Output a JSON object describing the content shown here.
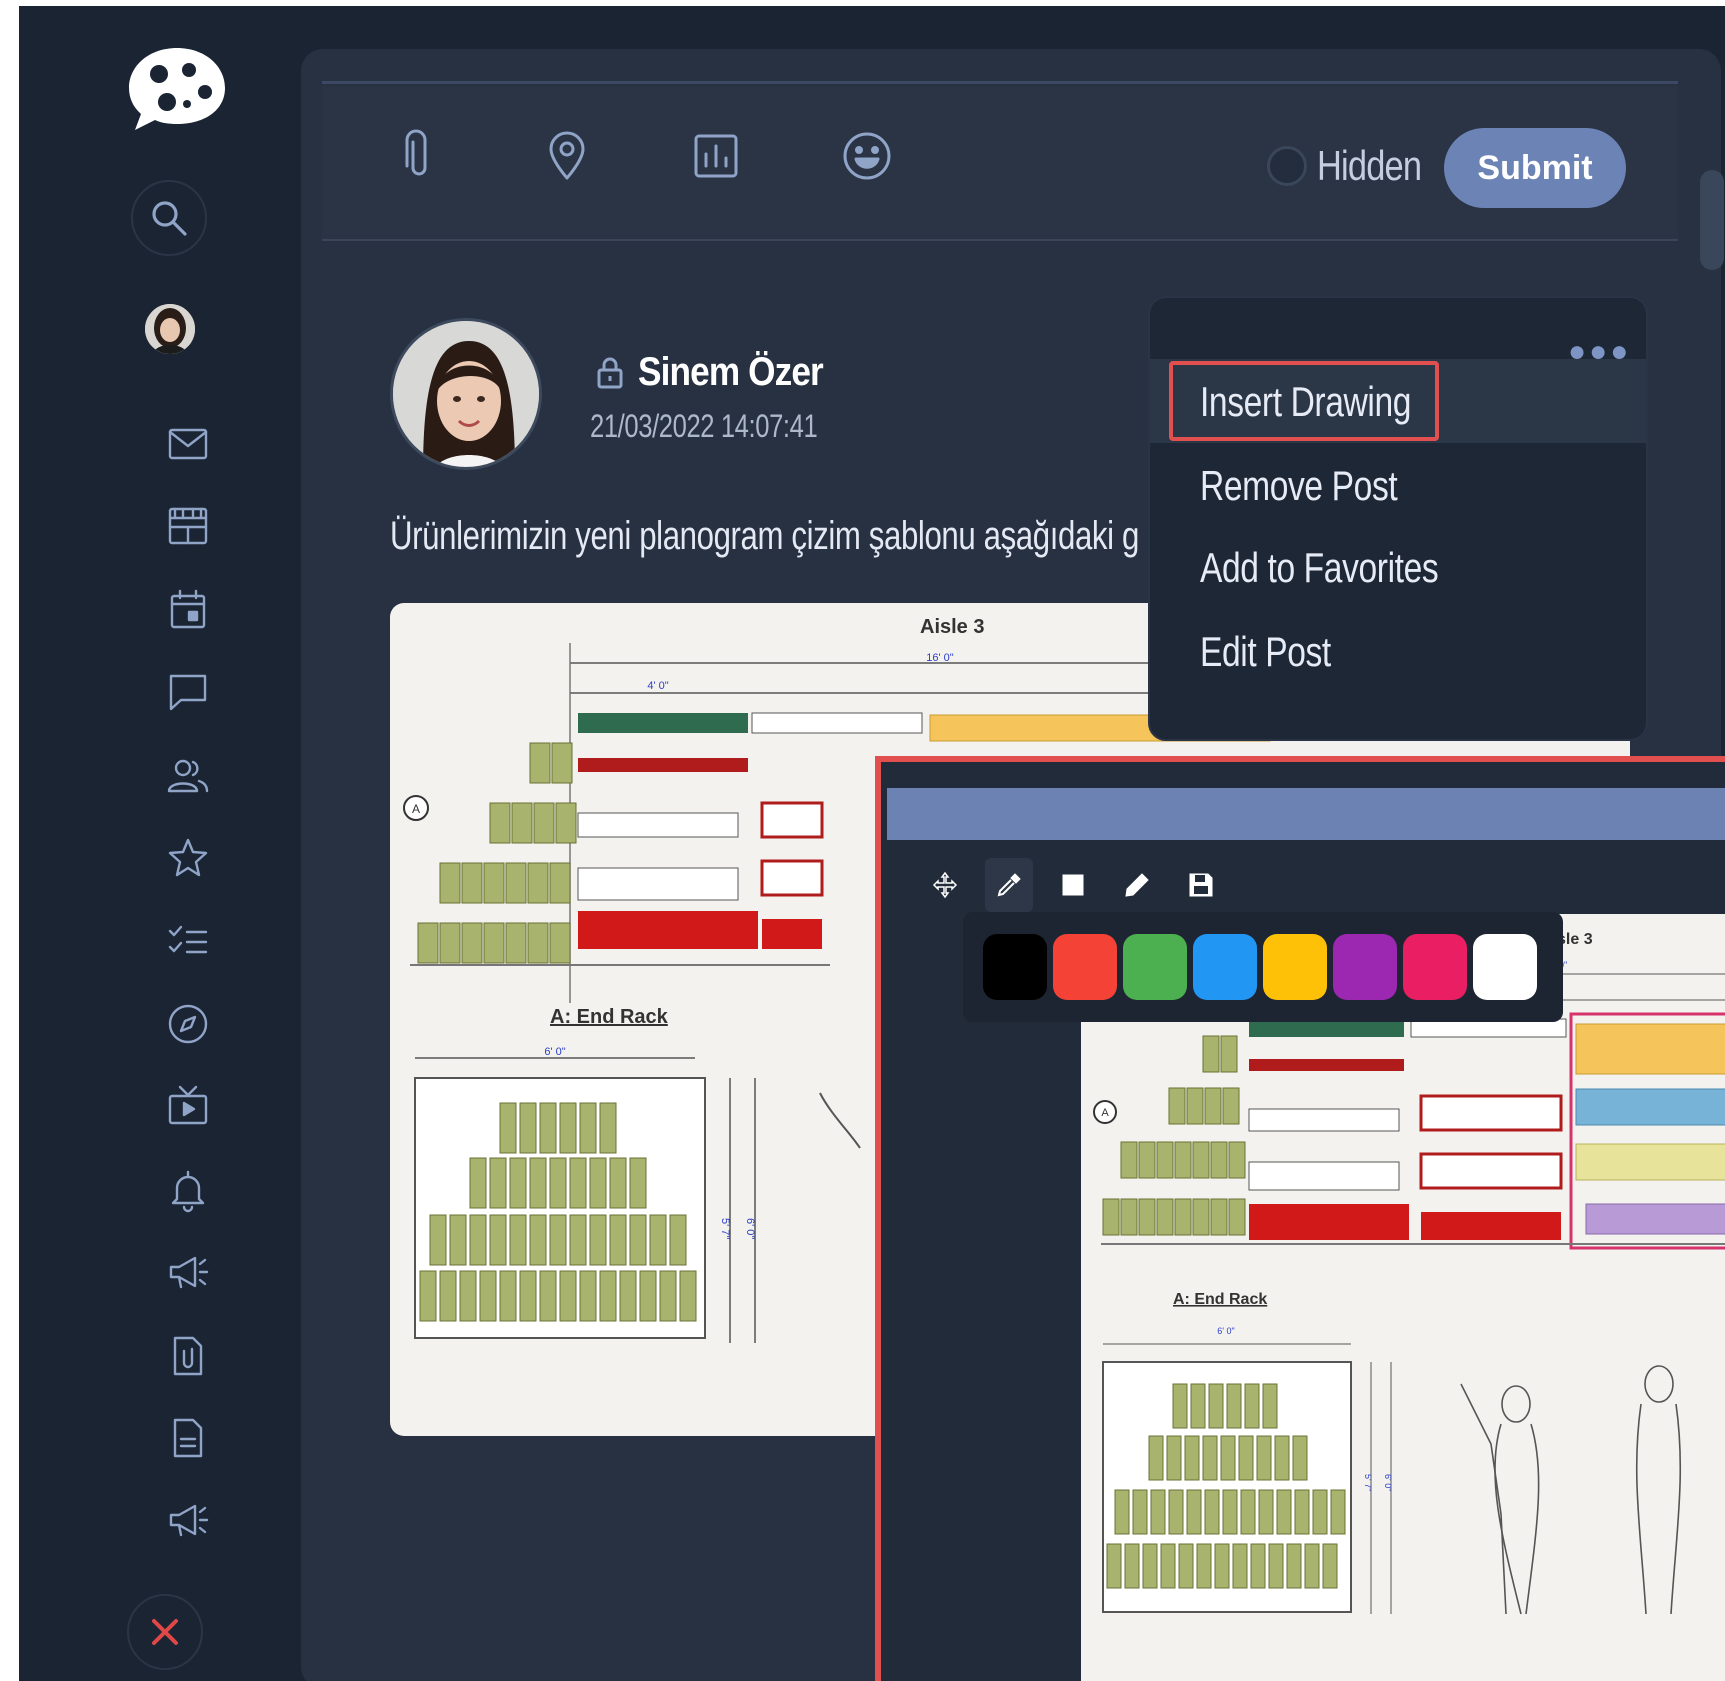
{
  "toolbar": {
    "hidden_label": "Hidden",
    "submit_label": "Submit"
  },
  "post": {
    "author": "Sinem Özer",
    "date": "21/03/2022 14:07:41",
    "text": "Ürünlerimizin yeni planogram çizim şablonu aşağıdaki g"
  },
  "menu": {
    "items": [
      {
        "label": "Insert Drawing"
      },
      {
        "label": "Remove Post"
      },
      {
        "label": "Add to Favorites"
      },
      {
        "label": "Edit Post"
      }
    ]
  },
  "planogram": {
    "aisle_label": "Aisle 3",
    "aisle_width": "16' 0\"",
    "end_rack_label": "A: End Rack",
    "end_rack_width": "6' 0\"",
    "section_width": "4' 0\"",
    "marker": "A",
    "heights": [
      "5' 7\"",
      "6' 0\""
    ]
  },
  "drawing": {
    "palette": [
      "#000000",
      "#f44336",
      "#4caf50",
      "#2196f3",
      "#ffc107",
      "#9c27b0",
      "#e91e63",
      "#ffffff"
    ],
    "tools": [
      "move-tool",
      "eyedropper-tool",
      "rectangle-tool",
      "pencil-tool",
      "save-tool"
    ]
  },
  "colors": {
    "accent": "#6c83b5",
    "sidebar_bg": "#1b2433",
    "panel_bg": "#273142",
    "highlight_red": "#e24f4f"
  }
}
